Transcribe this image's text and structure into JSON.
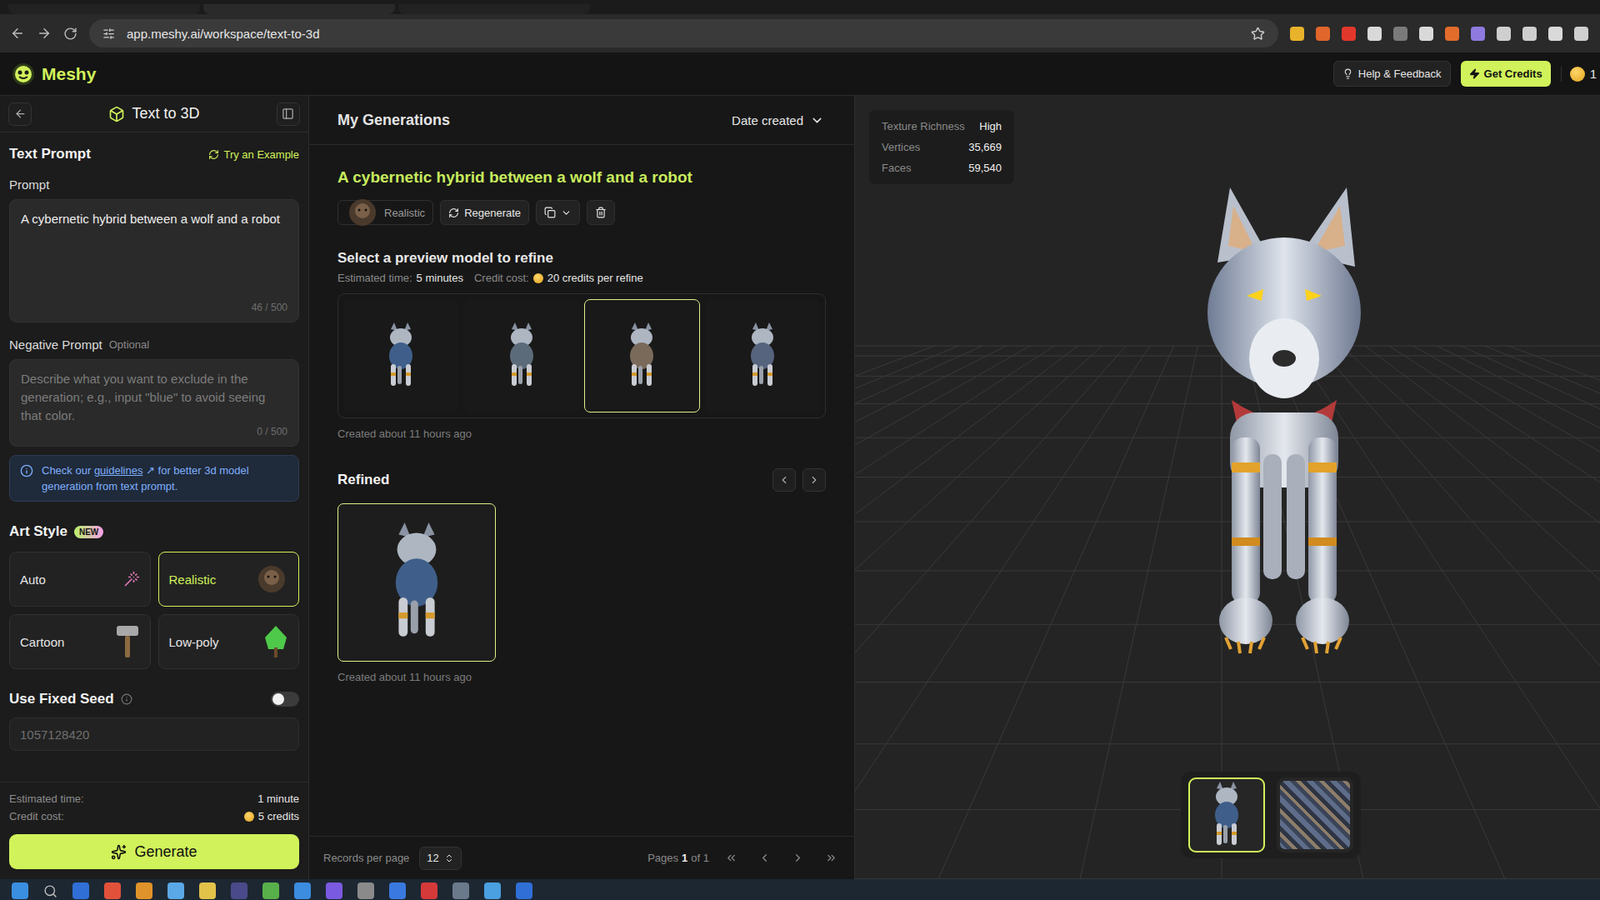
{
  "browser": {
    "url": "app.meshy.ai/workspace/text-to-3d"
  },
  "header": {
    "logo": "Meshy",
    "help": "Help & Feedback",
    "get_credits": "Get Credits",
    "credits": "1"
  },
  "left_panel": {
    "title": "Text to 3D",
    "section": "Text Prompt",
    "example": "Try an Example",
    "prompt": {
      "label": "Prompt",
      "value": "A cybernetic hybrid between a wolf and a robot",
      "counter": "46 / 500"
    },
    "negative": {
      "label": "Negative Prompt",
      "optional": "Optional",
      "placeholder": "Describe what you want to exclude in the generation; e.g., input \"blue\" to avoid seeing that color.",
      "counter": "0 / 500"
    },
    "info": {
      "before": "Check our",
      "link": "guidelines",
      "link_icon": "↗",
      "after": "for better 3d model generation from text prompt."
    },
    "art_style": {
      "label": "Art Style",
      "badge": "NEW",
      "options": [
        {
          "label": "Auto",
          "selected": false,
          "kind": "auto"
        },
        {
          "label": "Realistic",
          "selected": true,
          "kind": "realistic"
        },
        {
          "label": "Cartoon",
          "selected": false,
          "kind": "cartoon"
        },
        {
          "label": "Low-poly",
          "selected": false,
          "kind": "lowpoly"
        }
      ]
    },
    "seed": {
      "label": "Use Fixed Seed",
      "on": false,
      "value": "1057128420"
    },
    "estimate": [
      {
        "label": "Estimated time:",
        "value": "1 minute",
        "coin": false
      },
      {
        "label": "Credit cost:",
        "value": "5 credits",
        "coin": true
      }
    ],
    "generate": "Generate"
  },
  "generations": {
    "title": "My Generations",
    "sort": "Date created",
    "item": {
      "prompt": "A cybernetic hybrid between a wolf and a robot",
      "style": "Realistic",
      "regenerate": "Regenerate",
      "preview_heading": "Select a preview model to refine",
      "estimate": {
        "time_label": "Estimated time:",
        "time": "5 minutes",
        "cost_label": "Credit cost:",
        "cost": "20 credits per refine"
      },
      "previews": [
        {
          "selected": false
        },
        {
          "selected": false
        },
        {
          "selected": true
        },
        {
          "selected": false
        }
      ],
      "previews_created": "Created about 11 hours ago",
      "refined_heading": "Refined",
      "refined": [
        {
          "selected": true,
          "created": "Created about 11 hours ago"
        }
      ]
    },
    "footer": {
      "records_label": "Records per page",
      "records": "12",
      "pages_label": "Pages",
      "page": "1",
      "of": "of 1"
    }
  },
  "viewer": {
    "stats": [
      {
        "label": "Texture Richness",
        "value": "High"
      },
      {
        "label": "Vertices",
        "value": "35,669"
      },
      {
        "label": "Faces",
        "value": "59,540"
      }
    ],
    "thumbnails": [
      {
        "kind": "model",
        "selected": true
      },
      {
        "kind": "texture",
        "selected": false
      }
    ]
  }
}
